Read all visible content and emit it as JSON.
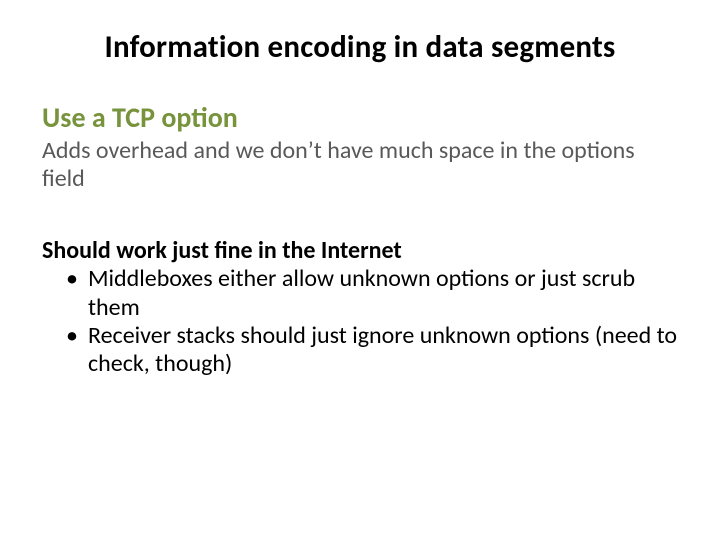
{
  "slide": {
    "title": "Information encoding in data segments",
    "subheading": "Use a TCP option",
    "description": "Adds overhead and we don’t have much space in the options field",
    "point_heading": "Should work just fine in the Internet",
    "bullets": [
      "Middleboxes either allow unknown options or just scrub them",
      "Receiver stacks should just ignore unknown options (need to check, though)"
    ]
  }
}
